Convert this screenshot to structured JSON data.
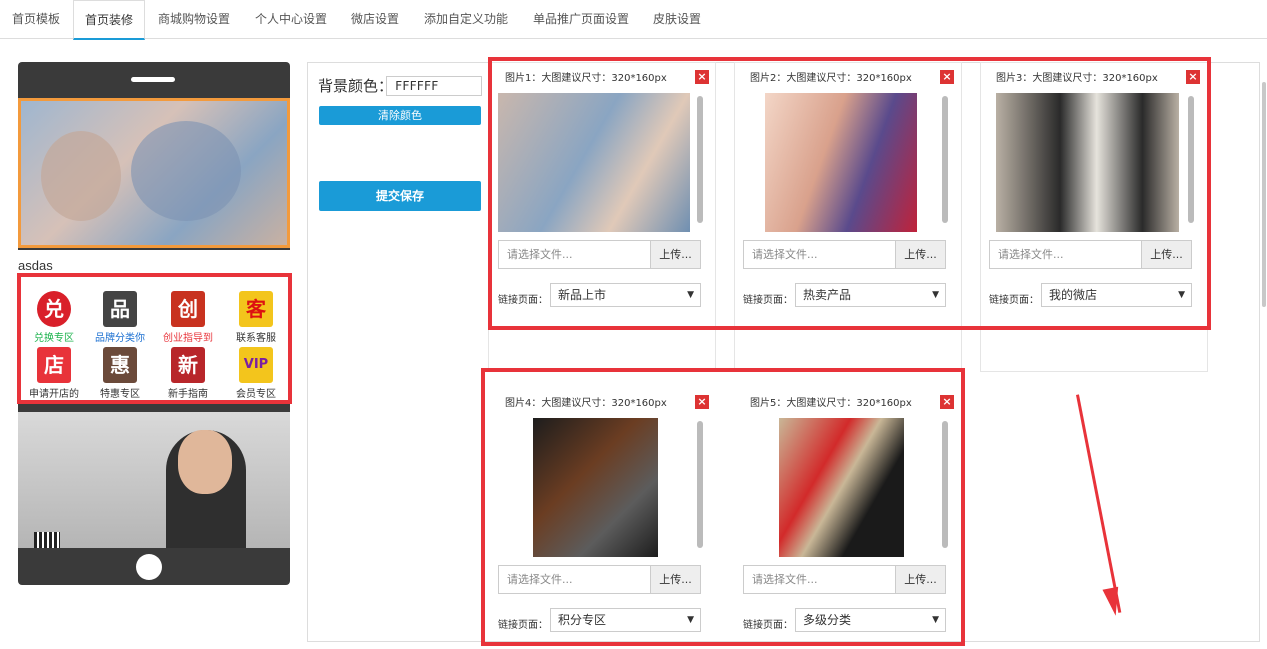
{
  "tabs": [
    {
      "label": "首页模板"
    },
    {
      "label": "首页装修"
    },
    {
      "label": "商城购物设置"
    },
    {
      "label": "个人中心设置"
    },
    {
      "label": "微店设置"
    },
    {
      "label": "添加自定义功能"
    },
    {
      "label": "单品推广页面设置"
    },
    {
      "label": "皮肤设置"
    }
  ],
  "active_tab": "首页装修",
  "preview": {
    "shop_name": "asdas",
    "grid_items": [
      {
        "label": "兑换专区",
        "color": "#1bb34c",
        "icon": "badge-icon",
        "glyph": "兑"
      },
      {
        "label": "品牌分类你",
        "color": "#1a6fd1",
        "icon": "brand-icon",
        "glyph": "品"
      },
      {
        "label": "创业指导到",
        "color": "#e8333a",
        "icon": "guide-icon",
        "glyph": "创"
      },
      {
        "label": "联系客服",
        "color": "#333333",
        "icon": "service-icon",
        "glyph": "客"
      },
      {
        "label": "申请开店的",
        "color": "#333333",
        "icon": "shop-icon",
        "glyph": "店"
      },
      {
        "label": "特惠专区",
        "color": "#333333",
        "icon": "sale-icon",
        "glyph": "惠"
      },
      {
        "label": "新手指南",
        "color": "#333333",
        "icon": "newbie-icon",
        "glyph": "新"
      },
      {
        "label": "会员专区",
        "color": "#333333",
        "icon": "vip-icon",
        "glyph": "VIP"
      }
    ]
  },
  "settings": {
    "bg_color_label": "背景颜色：",
    "bg_color_value": "FFFFFF",
    "clear_color_label": "清除颜色",
    "save_label": "提交保存"
  },
  "cards": [
    {
      "title": "图片1：大图建议尺寸：320*160px",
      "file_placeholder": "请选择文件...",
      "upload_label": "上传...",
      "link_label": "链接页面：",
      "link_value": "新品上市",
      "close": "×",
      "palette": [
        "#c9b7ad",
        "#8aa5c2",
        "#e0c9b8"
      ]
    },
    {
      "title": "图片2：大图建议尺寸：320*160px",
      "file_placeholder": "请选择文件...",
      "upload_label": "上传...",
      "link_label": "链接页面：",
      "link_value": "热卖产品",
      "close": "×",
      "palette": [
        "#f3d6c7",
        "#5a4a8c",
        "#c0223a"
      ]
    },
    {
      "title": "图片3：大图建议尺寸：320*160px",
      "file_placeholder": "请选择文件...",
      "upload_label": "上传...",
      "link_label": "链接页面：",
      "link_value": "我的微店",
      "close": "×",
      "palette": [
        "#b9b0a4",
        "#2a2a2a",
        "#e6e3dc"
      ]
    },
    {
      "title": "图片4：大图建议尺寸：320*160px",
      "file_placeholder": "请选择文件...",
      "upload_label": "上传...",
      "link_label": "链接页面：",
      "link_value": "积分专区",
      "close": "×",
      "palette": [
        "#1d1d1d",
        "#6b3d22",
        "#5c5c5c"
      ]
    },
    {
      "title": "图片5：大图建议尺寸：320*160px",
      "file_placeholder": "请选择文件...",
      "upload_label": "上传...",
      "link_label": "链接页面：",
      "link_value": "多级分类",
      "close": "×",
      "palette": [
        "#c9b797",
        "#d22a2a",
        "#1a1a1a"
      ]
    }
  ]
}
